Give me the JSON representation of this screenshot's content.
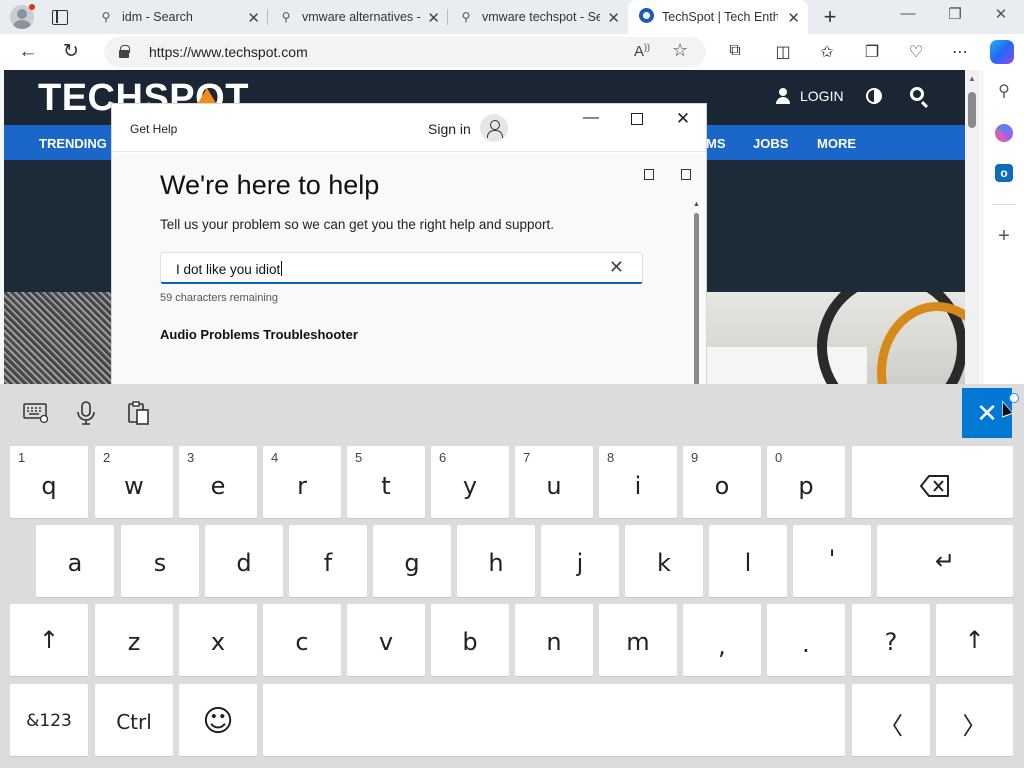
{
  "browser": {
    "tabs": [
      {
        "title": "idm - Search",
        "icon": "search-icon"
      },
      {
        "title": "vmware alternatives -",
        "icon": "search-icon"
      },
      {
        "title": "vmware techspot - Se",
        "icon": "search-icon"
      },
      {
        "title": "TechSpot | Tech Enth",
        "icon": "globe-icon",
        "active": true
      }
    ],
    "new_tab": "+",
    "url": "https://www.techspot.com",
    "controls": {
      "minimize": "—",
      "restore": "❐",
      "close": "✕"
    }
  },
  "site": {
    "logo": "TECHSPOT",
    "login": "LOGIN",
    "nav": [
      "TRENDING",
      "MS",
      "JOBS",
      "MORE"
    ]
  },
  "gethelp": {
    "title": "Get Help",
    "signin": "Sign in",
    "heading": "We're here to help",
    "subheading": "Tell us your problem so we can get you the right help and support.",
    "input_value": "I dot like  you idiot",
    "remaining": "59 characters remaining",
    "section_title": "Audio Problems Troubleshooter"
  },
  "keyboard": {
    "row1": [
      {
        "key": "q",
        "num": "1"
      },
      {
        "key": "w",
        "num": "2"
      },
      {
        "key": "e",
        "num": "3"
      },
      {
        "key": "r",
        "num": "4"
      },
      {
        "key": "t",
        "num": "5"
      },
      {
        "key": "y",
        "num": "6"
      },
      {
        "key": "u",
        "num": "7"
      },
      {
        "key": "i",
        "num": "8"
      },
      {
        "key": "o",
        "num": "9"
      },
      {
        "key": "p",
        "num": "0"
      }
    ],
    "row2": [
      "a",
      "s",
      "d",
      "f",
      "g",
      "h",
      "j",
      "k",
      "l",
      "'"
    ],
    "row3": [
      "z",
      "x",
      "c",
      "v",
      "b",
      "n",
      "m",
      ",",
      ".",
      "?"
    ],
    "shift": "↑",
    "enter": "↵",
    "symbols": "&123",
    "ctrl": "Ctrl",
    "emoji": "☺",
    "left": "〈",
    "right": "〉",
    "close": "✕"
  }
}
